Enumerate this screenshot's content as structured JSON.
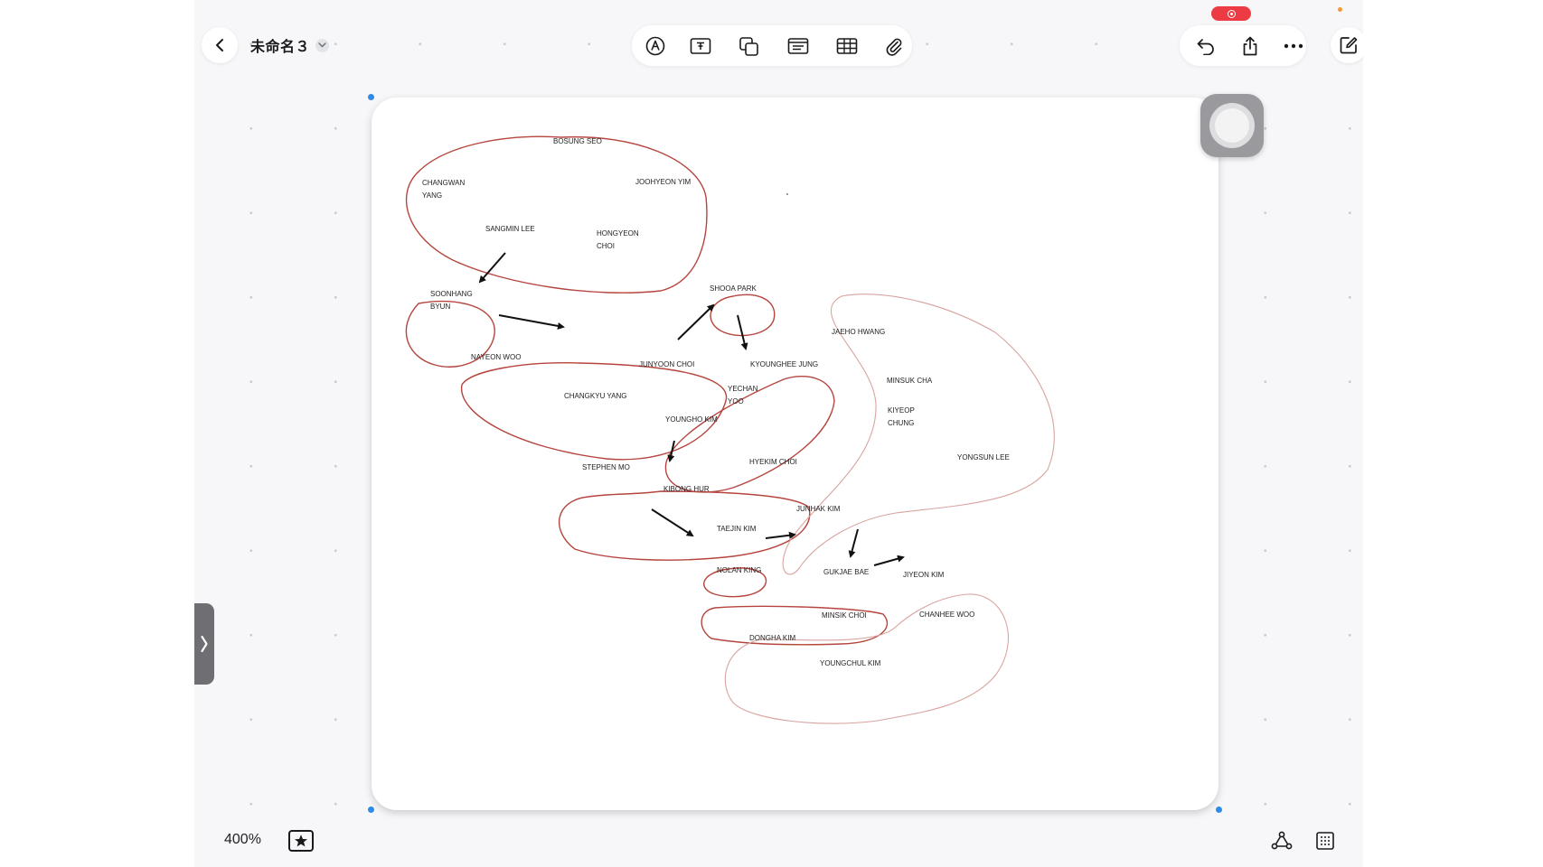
{
  "document": {
    "title": "未命名３"
  },
  "colors": {
    "loop_primary": "#b5453e",
    "loop_secondary": "#d9a4a0",
    "selection_handle": "#2f8be6",
    "record_pill": "#ec3b43"
  },
  "icons": {
    "back": "chevron-left-icon",
    "title_dropdown": "chevron-down-icon",
    "toolbar": [
      "pen-nib-icon",
      "text-box-icon",
      "shapes-icon",
      "sticky-note-icon",
      "table-icon",
      "paperclip-icon"
    ],
    "right_toolbar": [
      "undo-icon",
      "share-icon",
      "more-icon",
      "edit-icon"
    ],
    "record": "screen-record-icon",
    "side_tab": "chevron-right-icon",
    "favorite": "star-icon",
    "bottom_right": [
      "connector-nodes-icon",
      "grid-view-icon"
    ]
  },
  "footer": {
    "zoom": "400%"
  },
  "canvas": {
    "names": [
      "BOSUNG  SEO",
      "CHANGWAN YANG",
      "JOOHYEON YIM",
      "SANGMIN LEE",
      "HONGYEON CHOI",
      "SOONHANG BYUN",
      "SHOOA PARK",
      "NAYEON WOO",
      "JUNYOON CHOI",
      "CHANGKYU YANG",
      "KYOUNGHEE JUNG",
      "YECHAN YOO",
      "YOUNGHO KIM",
      "JAEHO HWANG",
      "MINSUK CHA",
      "KIYEOP CHUNG",
      "YONGSUN LEE",
      "STEPHEN MO",
      "HYEKIM CHOI",
      "KIBONG HUR",
      "JUNHAK KIM",
      "TAEJIN KIM",
      "NOLAN KING",
      "GUKJAE BAE",
      "JIYEON KIM",
      "MINSIK CHOI",
      "CHANHEE WOO",
      "DONGHA KIM",
      "YOUNGCHUL KIM"
    ]
  }
}
